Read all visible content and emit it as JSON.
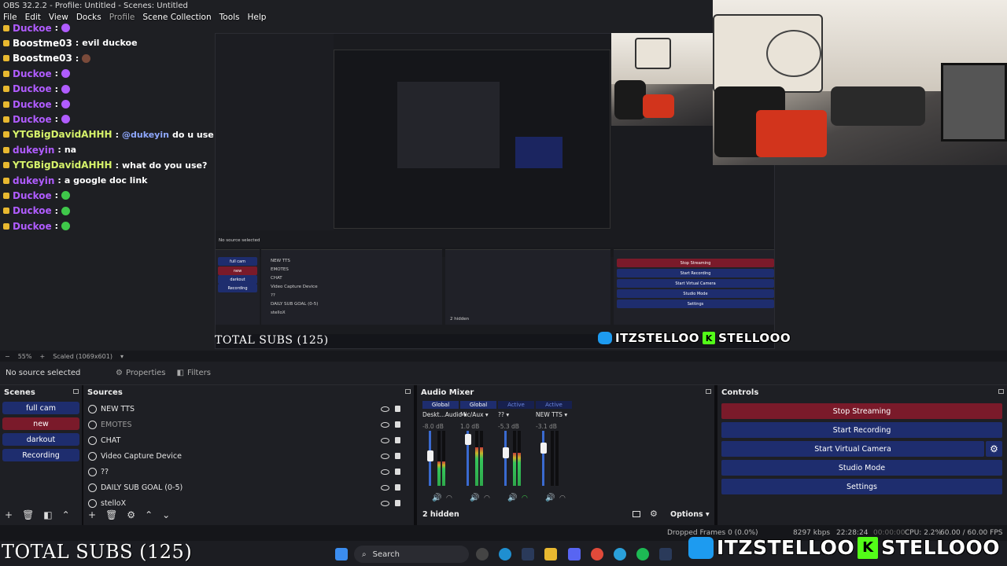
{
  "window": {
    "title": "OBS 32.2.2 - Profile: Untitled - Scenes: Untitled"
  },
  "menu": [
    "File",
    "Edit",
    "View",
    "Docks",
    "Profile",
    "Scene Collection",
    "Tools",
    "Help"
  ],
  "chat": [
    {
      "user": "Duckoe",
      "color": "#b05cff",
      "text": "",
      "emote": "#b05cff"
    },
    {
      "user": "Boostme03",
      "color": "#ffffff",
      "text": "evil duckoe",
      "emote": ""
    },
    {
      "user": "Boostme03",
      "color": "#ffffff",
      "text": "",
      "emote": "#7a4a3a"
    },
    {
      "user": "Duckoe",
      "color": "#b05cff",
      "text": "",
      "emote": "#b05cff"
    },
    {
      "user": "Duckoe",
      "color": "#b05cff",
      "text": "",
      "emote": "#b05cff"
    },
    {
      "user": "Duckoe",
      "color": "#b05cff",
      "text": "",
      "emote": "#b05cff"
    },
    {
      "user": "Duckoe",
      "color": "#b05cff",
      "text": "",
      "emote": "#b05cff"
    },
    {
      "user": "YTGBigDavidAHHH",
      "color": "#d6f26a",
      "mention": "@dukeyin",
      "text": "do u use google translate",
      "emote": ""
    },
    {
      "user": "dukeyin",
      "color": "#b05cff",
      "text": "na",
      "emote": ""
    },
    {
      "user": "YTGBigDavidAHHH",
      "color": "#d6f26a",
      "text": "what do you use?",
      "emote": ""
    },
    {
      "user": "dukeyin",
      "color": "#b05cff",
      "text": "a google doc link",
      "emote": ""
    },
    {
      "user": "Duckoe",
      "color": "#b05cff",
      "text": "",
      "emote": "#3fc84a"
    },
    {
      "user": "Duckoe",
      "color": "#b05cff",
      "text": "",
      "emote": "#3fc84a"
    },
    {
      "user": "Duckoe",
      "color": "#b05cff",
      "text": "",
      "emote": "#3fc84a"
    }
  ],
  "overlay": {
    "subs_text": "TOTAL SUBS (125)",
    "twitter_handle": "ITZSTELLOO",
    "kick_handle": "STELLOOO",
    "kick_letter": "K"
  },
  "nested": {
    "subs_text": "TOTAL SUBS (125)",
    "scenes": [
      "full cam",
      "new",
      "darkout",
      "Recording"
    ],
    "sources": [
      "NEW TTS",
      "EMOTES",
      "CHAT",
      "Video Capture Device",
      "??",
      "DAILY SUB GOAL (0-5)",
      "stelloX"
    ],
    "controls": [
      "Stop Streaming",
      "Start Recording",
      "Start Virtual Camera",
      "Studio Mode",
      "Settings"
    ],
    "no_source": "No source selected",
    "hidden": "2 hidden"
  },
  "zoombar": {
    "zoom": "55%",
    "scaled": "Scaled (1069x601)"
  },
  "sourcebar": {
    "no_source": "No source selected",
    "properties": "Properties",
    "filters": "Filters"
  },
  "scenes": {
    "title": "Scenes",
    "items": [
      {
        "label": "full cam",
        "active": false
      },
      {
        "label": "new",
        "active": true
      },
      {
        "label": "darkout",
        "active": false
      },
      {
        "label": "Recording",
        "active": false
      }
    ]
  },
  "sources": {
    "title": "Sources",
    "items": [
      {
        "label": "NEW TTS",
        "dim": false
      },
      {
        "label": "EMOTES",
        "dim": true
      },
      {
        "label": "CHAT",
        "dim": false
      },
      {
        "label": "Video Capture Device",
        "dim": false
      },
      {
        "label": "??",
        "dim": false
      },
      {
        "label": "DAILY SUB GOAL (0-5)",
        "dim": false
      },
      {
        "label": "stelloX",
        "dim": false
      }
    ]
  },
  "mixer": {
    "title": "Audio Mixer",
    "channels": [
      {
        "head": "Global",
        "name": "Deskt...Audio",
        "db": "-8.0 dB",
        "level": 0.45,
        "fader": 0.55
      },
      {
        "head": "Global",
        "name": "Mic/Aux",
        "db": "1.0 dB",
        "level": 0.7,
        "fader": 0.85
      },
      {
        "head": "Active",
        "name": "??",
        "db": "-5.3 dB",
        "level": 0.6,
        "fader": 0.6
      },
      {
        "head": "Active",
        "name": "NEW TTS",
        "db": "-3.1 dB",
        "level": 0.0,
        "fader": 0.68
      }
    ],
    "hidden": "2 hidden",
    "options": "Options"
  },
  "controls": {
    "title": "Controls",
    "buttons": [
      {
        "label": "Stop Streaming",
        "color": "#7a1a2a"
      },
      {
        "label": "Start Recording",
        "color": "#1e2d6e"
      },
      {
        "label": "Start Virtual Camera",
        "color": "#1e2d6e"
      },
      {
        "label": "Studio Mode",
        "color": "#1e2d6e"
      },
      {
        "label": "Settings",
        "color": "#1e2d6e"
      }
    ]
  },
  "status": {
    "dropped": "Dropped Frames 0 (0.0%)",
    "kbps": "8297 kbps",
    "live_time": "22:28:24",
    "rec_time": "00:00:00",
    "cpu": "CPU: 2.2%",
    "fps": "60.00 / 60.00 FPS"
  },
  "taskbar": {
    "search": "Search"
  },
  "colors": {
    "accent": "#1e2d6e",
    "scene_active": "#7a1a2a",
    "streaming": "#7a1a2a"
  }
}
